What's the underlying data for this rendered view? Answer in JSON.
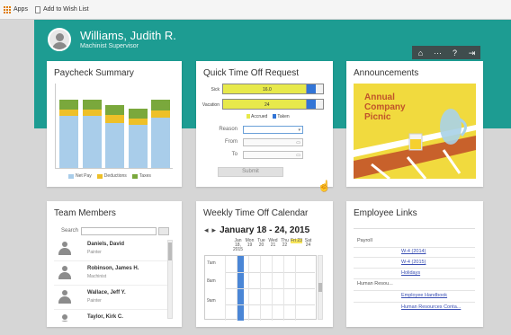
{
  "browser": {
    "bookmarks": [
      {
        "label": "Apps",
        "icon": "apps-grid-icon"
      },
      {
        "label": "Add to Wish List",
        "icon": "page-icon"
      }
    ]
  },
  "header": {
    "user_name": "Williams, Judith R.",
    "user_title": "Machinist Supervisor",
    "tools": [
      "home-icon",
      "more-icon",
      "help-icon",
      "logout-icon"
    ],
    "tool_glyphs": {
      "home": "⌂",
      "more": "···",
      "help": "?",
      "logout": "⇥"
    },
    "accent": "#1d9c92"
  },
  "paycheck": {
    "title": "Paycheck Summary",
    "legend": [
      "Net Pay",
      "Deductions",
      "Taxes"
    ],
    "colors": {
      "net_pay": "#a9cdea",
      "deductions": "#eec028",
      "taxes": "#7aa83c"
    },
    "chart_data": {
      "type": "bar",
      "stacked": true,
      "categories": [
        "1",
        "2",
        "3",
        "4",
        "5"
      ],
      "series": [
        {
          "name": "Net Pay",
          "values": [
            61,
            61,
            53,
            51,
            59
          ]
        },
        {
          "name": "Deductions",
          "values": [
            7,
            7,
            9,
            7,
            8
          ]
        },
        {
          "name": "Taxes",
          "values": [
            12,
            12,
            12,
            11,
            13
          ]
        }
      ],
      "ylim": [
        0,
        100
      ]
    }
  },
  "quick_time_off": {
    "title": "Quick Time Off Request",
    "rows": [
      {
        "label": "Sick",
        "value": "16.0",
        "accrued_fraction": 0.84,
        "taken_fraction": 0.09
      },
      {
        "label": "Vacation",
        "value": "24",
        "accrued_fraction": 0.84,
        "taken_fraction": 0.09
      }
    ],
    "legend": [
      "Accrued",
      "Taken"
    ],
    "legend_colors": {
      "accrued": "#e7e94b",
      "taken": "#3375d6"
    },
    "fields": {
      "reason_label": "Reason",
      "from_label": "From",
      "to_label": "To",
      "reason_value": "",
      "from_value": "",
      "to_value": ""
    },
    "submit_label": "Submit"
  },
  "announcements": {
    "title": "Announcements",
    "headline_lines": [
      "Annual",
      "Company",
      "Picnic"
    ]
  },
  "team_members": {
    "title": "Team Members",
    "search_label": "Search",
    "search_value": "",
    "members": [
      {
        "name": "Daniels, David",
        "title": "Painter"
      },
      {
        "name": "Robinson, James H.",
        "title": "Machinist"
      },
      {
        "name": "Wallace, Jeff Y.",
        "title": "Painter"
      },
      {
        "name": "Taylor, Kirk C.",
        "title": ""
      }
    ]
  },
  "weekly_calendar": {
    "title": "Weekly Time Off Calendar",
    "range_label": "January 18 - 24, 2015",
    "nav_prev": "◂",
    "nav_next": "▸",
    "days": [
      {
        "label": "Jan 18, 2015"
      },
      {
        "label": "Mon 19"
      },
      {
        "label": "Tue 20"
      },
      {
        "label": "Wed 21"
      },
      {
        "label": "Thu 22"
      },
      {
        "label": "Fri 23",
        "highlight": true
      },
      {
        "label": "Sat 24"
      }
    ],
    "times": [
      "7am",
      "8am",
      "9am"
    ],
    "busy_color": "#4a86d6"
  },
  "employee_links": {
    "title": "Employee Links",
    "groups": [
      {
        "name": "Payroll",
        "links": [
          "W-4 (2014)",
          "W-4 (2015)",
          "Holidays"
        ]
      },
      {
        "name": "Human Resou...",
        "links": [
          "Employee Handbook",
          "Human Resources Conta..."
        ]
      }
    ]
  }
}
